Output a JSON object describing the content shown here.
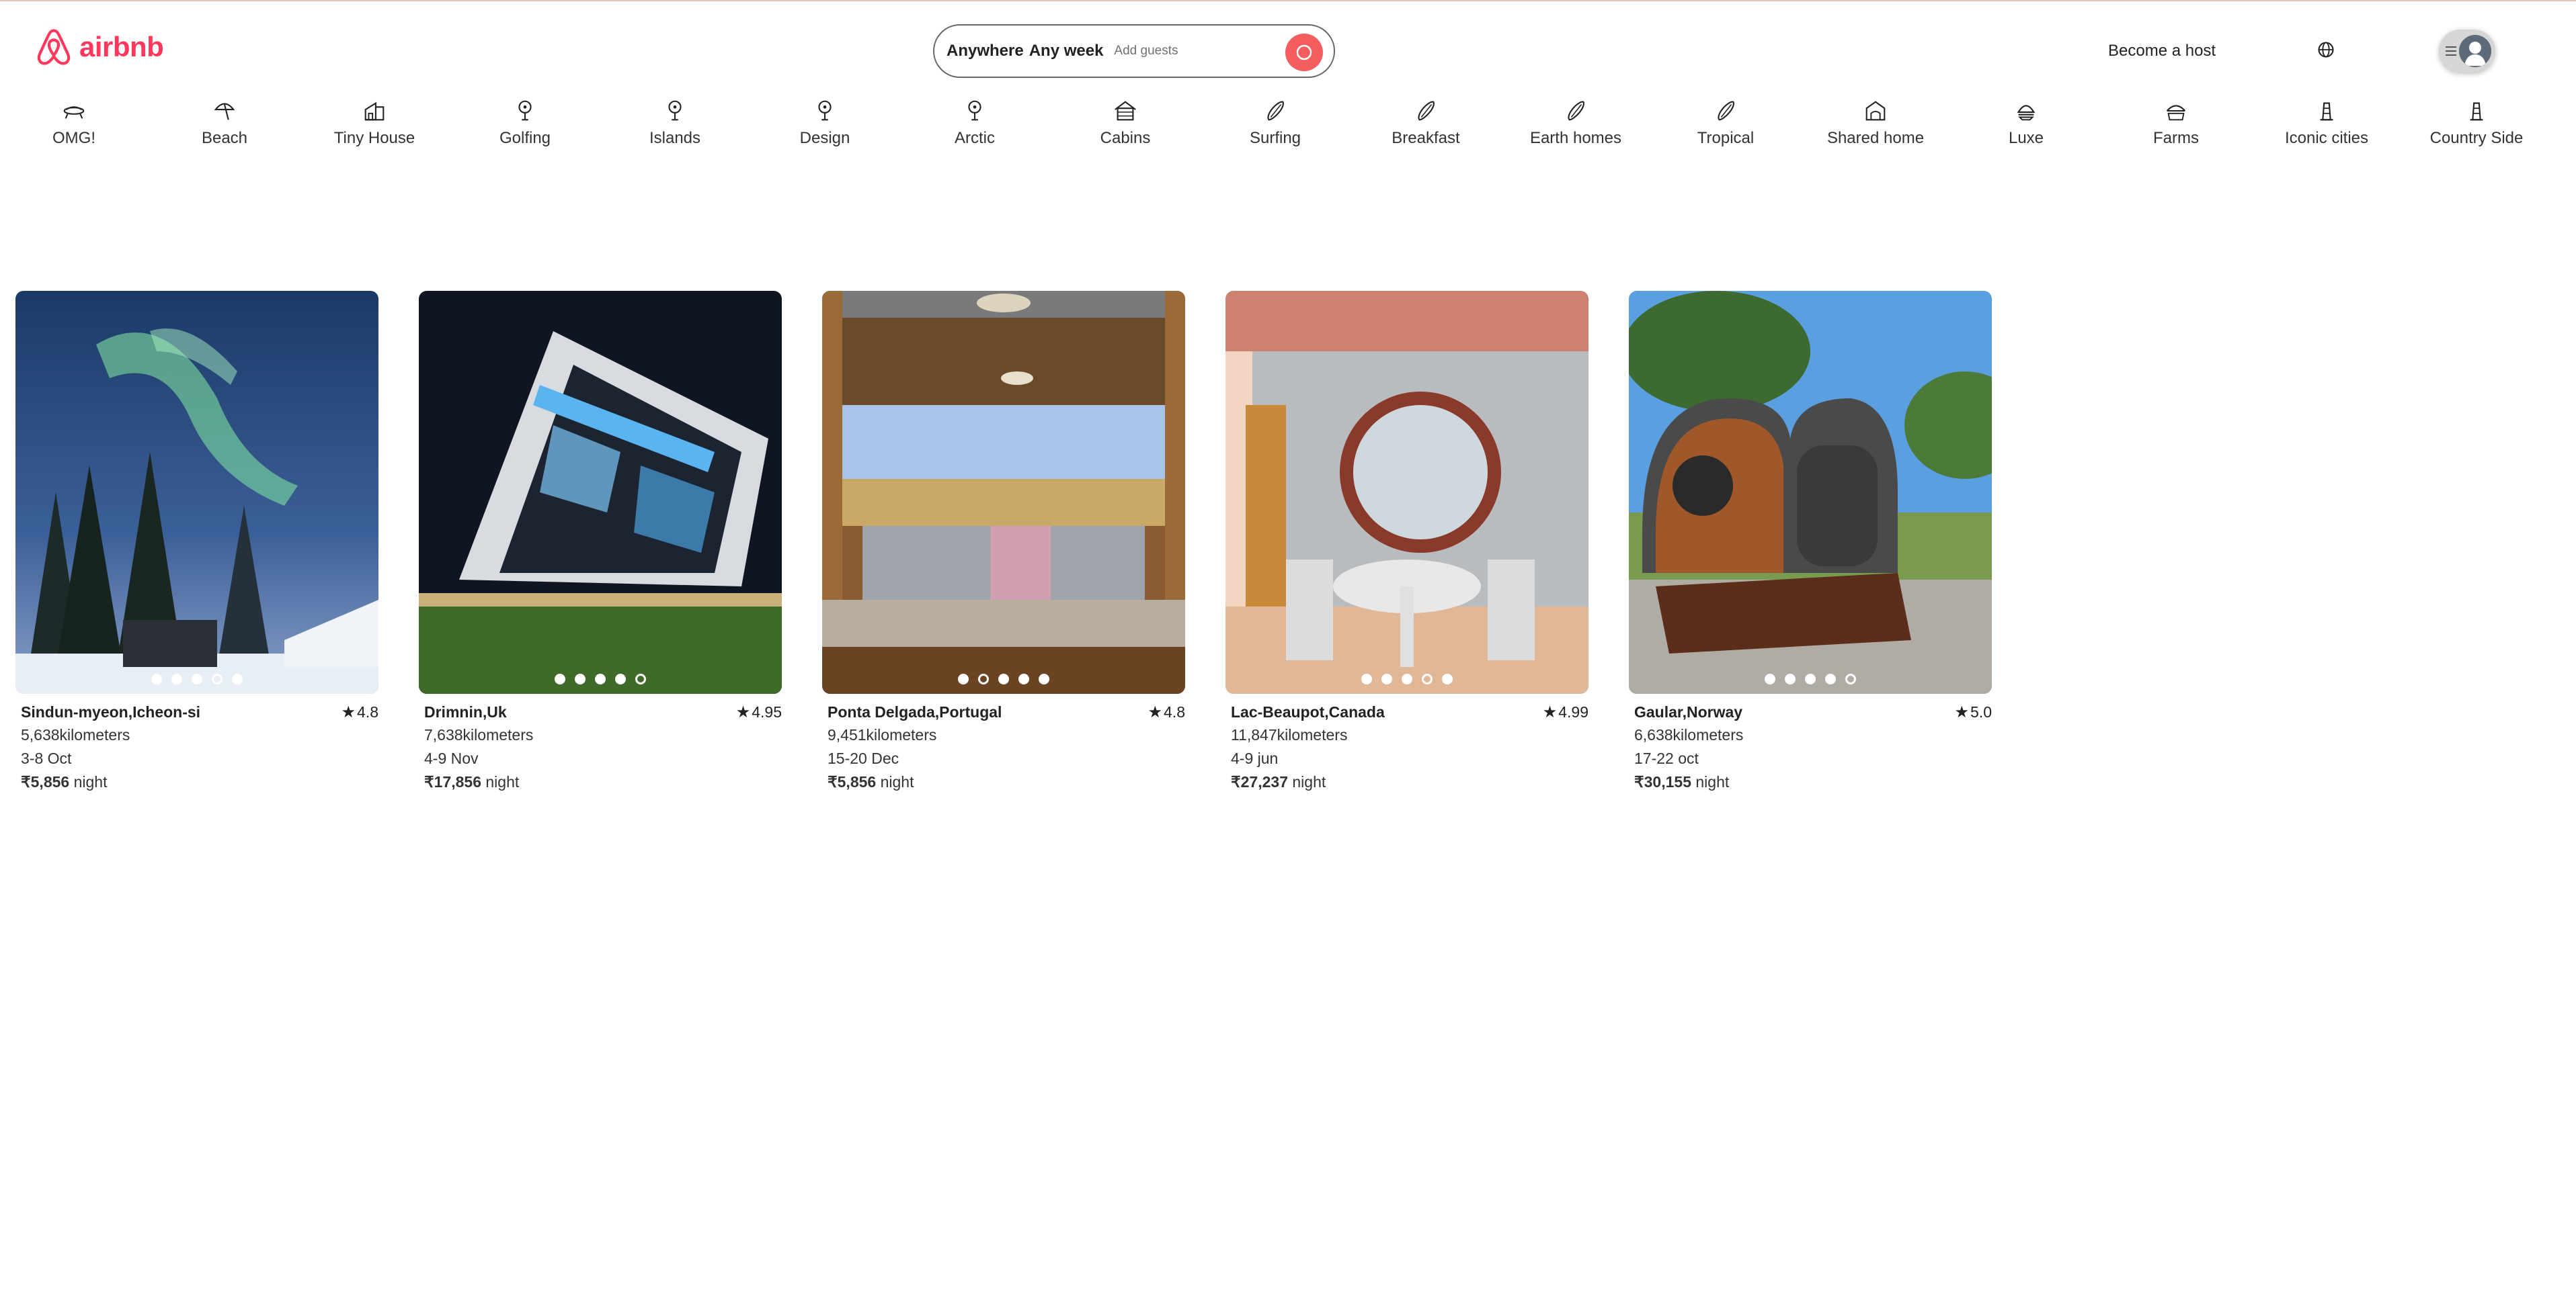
{
  "header": {
    "logo_text": "airbnb",
    "search": {
      "anywhere": "Anywhere",
      "any_week": "Any week",
      "add_guests": "Add guests"
    },
    "become_host": "Become a host",
    "globe_icon": "globe-icon",
    "profile_icon": "avatar-icon"
  },
  "categories": [
    {
      "label": "OMG!",
      "icon": "ufo-icon"
    },
    {
      "label": "Beach",
      "icon": "umbrella-icon"
    },
    {
      "label": "Tiny House",
      "icon": "tiny-house-icon"
    },
    {
      "label": "Golfing",
      "icon": "pin-icon"
    },
    {
      "label": "Islands",
      "icon": "pin-icon"
    },
    {
      "label": "Design",
      "icon": "pin-icon"
    },
    {
      "label": "Arctic",
      "icon": "pin-icon"
    },
    {
      "label": "Cabins",
      "icon": "cabin-icon"
    },
    {
      "label": "Surfing",
      "icon": "surfboard-icon"
    },
    {
      "label": "Breakfast",
      "icon": "surfboard-icon"
    },
    {
      "label": "Earth homes",
      "icon": "surfboard-icon"
    },
    {
      "label": "Tropical",
      "icon": "surfboard-icon"
    },
    {
      "label": "Shared home",
      "icon": "shared-home-icon"
    },
    {
      "label": "Luxe",
      "icon": "luxe-icon"
    },
    {
      "label": "Farms",
      "icon": "farm-icon"
    },
    {
      "label": "Iconic cities",
      "icon": "tower-icon"
    },
    {
      "label": "Country Side",
      "icon": "tower-icon"
    }
  ],
  "listings": [
    {
      "location": "Sindun-myeon,Icheon-si",
      "rating": "4.8",
      "distance": "5,638kilometers",
      "dates": "3-8 Oct",
      "price": "₹5,856",
      "price_unit": "night",
      "active_dot": 3,
      "dot_count": 5
    },
    {
      "location": "Drimnin,Uk",
      "rating": "4.95",
      "distance": "7,638kilometers",
      "dates": "4-9 Nov",
      "price": "₹17,856",
      "price_unit": "night",
      "active_dot": 4,
      "dot_count": 5
    },
    {
      "location": "Ponta Delgada,Portugal",
      "rating": "4.8",
      "distance": "9,451kilometers",
      "dates": "15-20 Dec",
      "price": "₹5,856",
      "price_unit": "night",
      "active_dot": 1,
      "dot_count": 5
    },
    {
      "location": "Lac-Beaupot,Canada",
      "rating": "4.99",
      "distance": "11,847kilometers",
      "dates": "4-9 jun",
      "price": "₹27,237",
      "price_unit": "night",
      "active_dot": 3,
      "dot_count": 5
    },
    {
      "location": "Gaular,Norway",
      "rating": "5.0",
      "distance": "6,638kilometers",
      "dates": "17-22 oct",
      "price": "₹30,155",
      "price_unit": "night",
      "active_dot": 4,
      "dot_count": 5
    }
  ]
}
